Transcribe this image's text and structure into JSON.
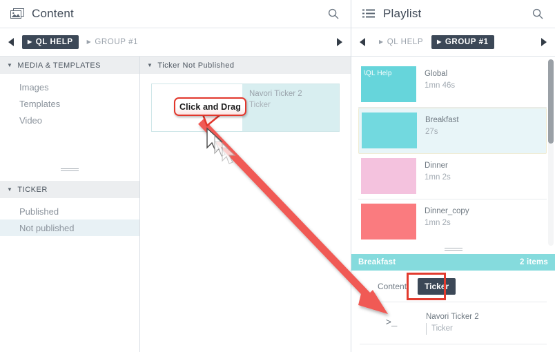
{
  "left_panel": {
    "title": "Content",
    "icon": "image-stack-icon",
    "search_icon": "search-icon",
    "breadcrumb": {
      "prev_icon": "chevron-left-icon",
      "next_icon": "chevron-right-icon",
      "items": [
        {
          "label": "QL HELP",
          "active": true
        },
        {
          "label": "GROUP #1",
          "active": false
        }
      ]
    },
    "sidebar": {
      "sections": [
        {
          "title": "MEDIA & TEMPLATES",
          "items": [
            {
              "label": "Images",
              "selected": false
            },
            {
              "label": "Templates",
              "selected": false
            },
            {
              "label": "Video",
              "selected": false
            }
          ]
        },
        {
          "title": "TICKER",
          "items": [
            {
              "label": "Published",
              "selected": false
            },
            {
              "label": "Not published",
              "selected": true
            }
          ]
        }
      ]
    },
    "center": {
      "section_title": "Ticker Not Published",
      "card": {
        "name": "Navori Ticker 2",
        "subtitle": "Ticker"
      }
    }
  },
  "right_panel": {
    "title": "Playlist",
    "icon": "list-icon",
    "search_icon": "search-icon",
    "breadcrumb": {
      "prev_icon": "chevron-left-icon",
      "next_icon": "chevron-right-icon",
      "items": [
        {
          "label": "QL HELP",
          "active": false
        },
        {
          "label": "GROUP #1",
          "active": true
        }
      ]
    },
    "playlist_items": [
      {
        "name": "Global",
        "duration": "1mn 46s",
        "thumb_color": "#66d5db",
        "thumb_label": "\\QL Help",
        "selected": false
      },
      {
        "name": "Breakfast",
        "duration": "27s",
        "thumb_color": "#72d9df",
        "thumb_label": "",
        "selected": true
      },
      {
        "name": "Dinner",
        "duration": "1mn 2s",
        "thumb_color": "#f4c2de",
        "thumb_label": "",
        "selected": false
      },
      {
        "name": "Dinner_copy",
        "duration": "1mn 2s",
        "thumb_color": "#fa7b7f",
        "thumb_label": "",
        "selected": false
      }
    ],
    "group_bar": {
      "name": "Breakfast",
      "count": "2 items",
      "color": "#85dbdd"
    },
    "tabs": [
      {
        "label": "Content",
        "active": false
      },
      {
        "label": "Ticker",
        "active": true
      }
    ],
    "detail_items": [
      {
        "icon": ">_",
        "title": "Navori Ticker 2",
        "subtitle": "Ticker"
      }
    ]
  },
  "annotations": {
    "callout_label": "Click and Drag",
    "callout_color": "#e2372c",
    "arrow_color": "#f05a54",
    "highlight_color": "#e23b2e"
  }
}
